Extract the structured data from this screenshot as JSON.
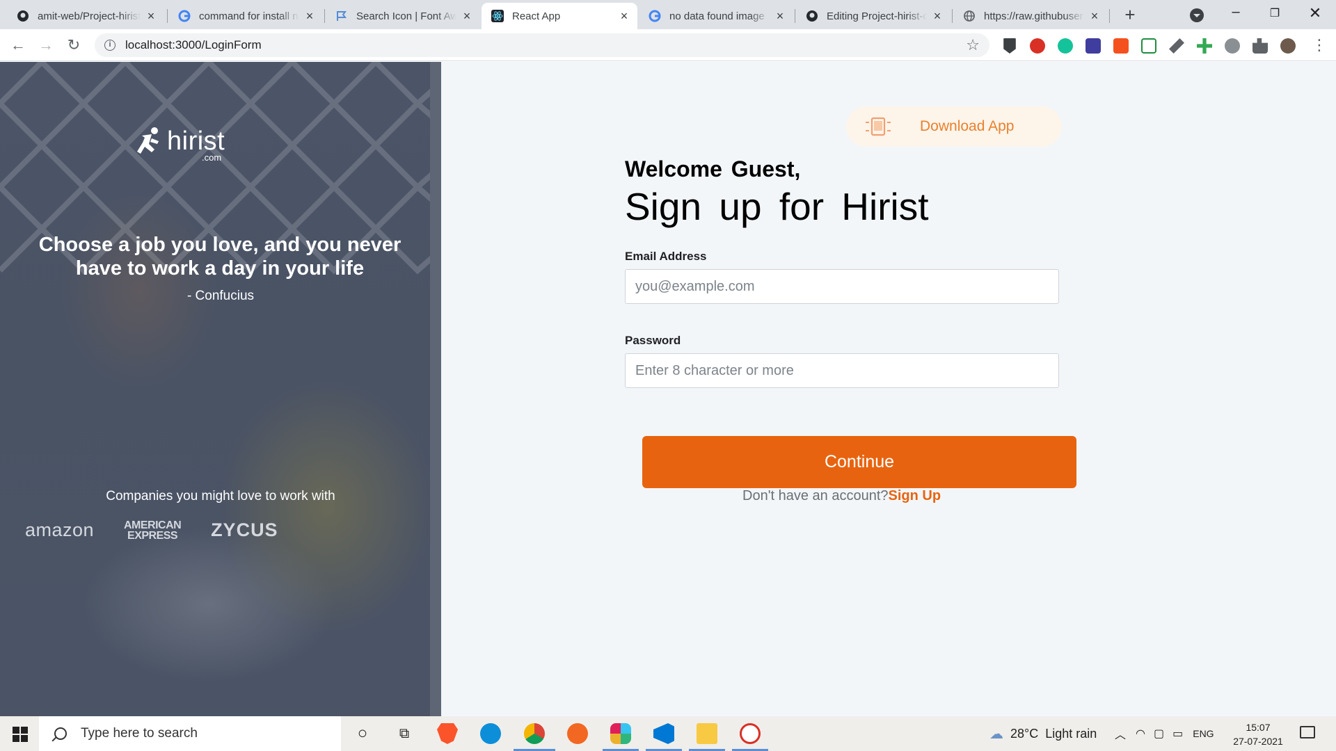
{
  "browser": {
    "tabs": [
      {
        "title": "amit-web/Project-hirist",
        "favicon": "github-icon",
        "active": false
      },
      {
        "title": "command for install npm",
        "favicon": "google-icon",
        "active": false
      },
      {
        "title": "Search Icon | Font Awesome",
        "favicon": "fontawesome-flag-icon",
        "active": false
      },
      {
        "title": "React App",
        "favicon": "react-icon",
        "active": true
      },
      {
        "title": "no data found image",
        "favicon": "google-icon",
        "active": false
      },
      {
        "title": "Editing Project-hirist-client",
        "favicon": "github-icon",
        "active": false
      },
      {
        "title": "https://raw.githubusercontent.com",
        "favicon": "globe-icon",
        "active": false
      }
    ],
    "url": "localhost:3000/LoginForm"
  },
  "left_panel": {
    "logo_name": "hirist",
    "logo_suffix": ".com",
    "quote": "Choose a job you love, and you never have to work a day in your life",
    "author": "- Confucius",
    "companies_title": "Companies you might love to work with",
    "company_logos": [
      "amazon",
      "AMERICAN EXPRESS",
      "ZYCUS"
    ]
  },
  "main": {
    "download_label": "Download App",
    "welcome": "Welcome Guest,",
    "title": "Sign up for Hirist",
    "email_label": "Email Address",
    "email_placeholder": "you@example.com",
    "password_label": "Password",
    "password_placeholder": "Enter 8 character or more",
    "continue_label": "Continue",
    "no_account_text": "Don't have an account?",
    "sign_up_link": "Sign Up",
    "accent_color": "#e8630f"
  },
  "taskbar": {
    "search_placeholder": "Type here to search",
    "weather": "28°C  Light rain",
    "language": "ENG",
    "time": "15:07",
    "date": "27-07-2021"
  }
}
